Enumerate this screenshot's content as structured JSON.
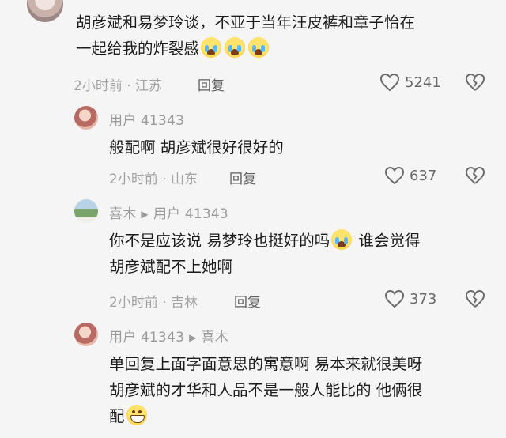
{
  "comments": [
    {
      "lines": [
        "胡彦斌和易梦玲谈，不亚于当年汪皮裤和章子怡在",
        "一起给我的炸裂感"
      ],
      "emoji_count": 3,
      "time": "2小时前",
      "location": "江苏",
      "reply_label": "回复",
      "likes": "5241"
    }
  ],
  "replies": [
    {
      "author": "用户 41343",
      "lines": [
        "般配啊 胡彦斌很好很好的"
      ],
      "time": "2小时前",
      "location": "山东",
      "reply_label": "回复",
      "likes": "637"
    },
    {
      "author": "喜木",
      "reply_to": "用户 41343",
      "lines": [
        "你不是应该说 易梦玲也挺好的吗",
        "谁会觉得",
        "胡彦斌配不上她啊"
      ],
      "time": "2小时前",
      "location": "吉林",
      "reply_label": "回复",
      "likes": "373"
    },
    {
      "author": "用户 41343",
      "reply_to": "喜木",
      "lines": [
        "单回复上面字面意思的寓意啊  易本来就很美呀",
        "胡彦斌的才华和人品不是一般人能比的 他俩很",
        "配"
      ]
    }
  ],
  "icons": {
    "like": "heart-outline-icon",
    "dislike": "broken-heart-icon",
    "reply_arrow": "right-triangle-icon",
    "emoji_cry": "crying-laughing-emoji",
    "emoji_grin": "grinning-emoji"
  },
  "colors": {
    "background": "#f5f5f5",
    "meta_text": "#9a9a9a",
    "body_text": "#1c1c1c"
  }
}
